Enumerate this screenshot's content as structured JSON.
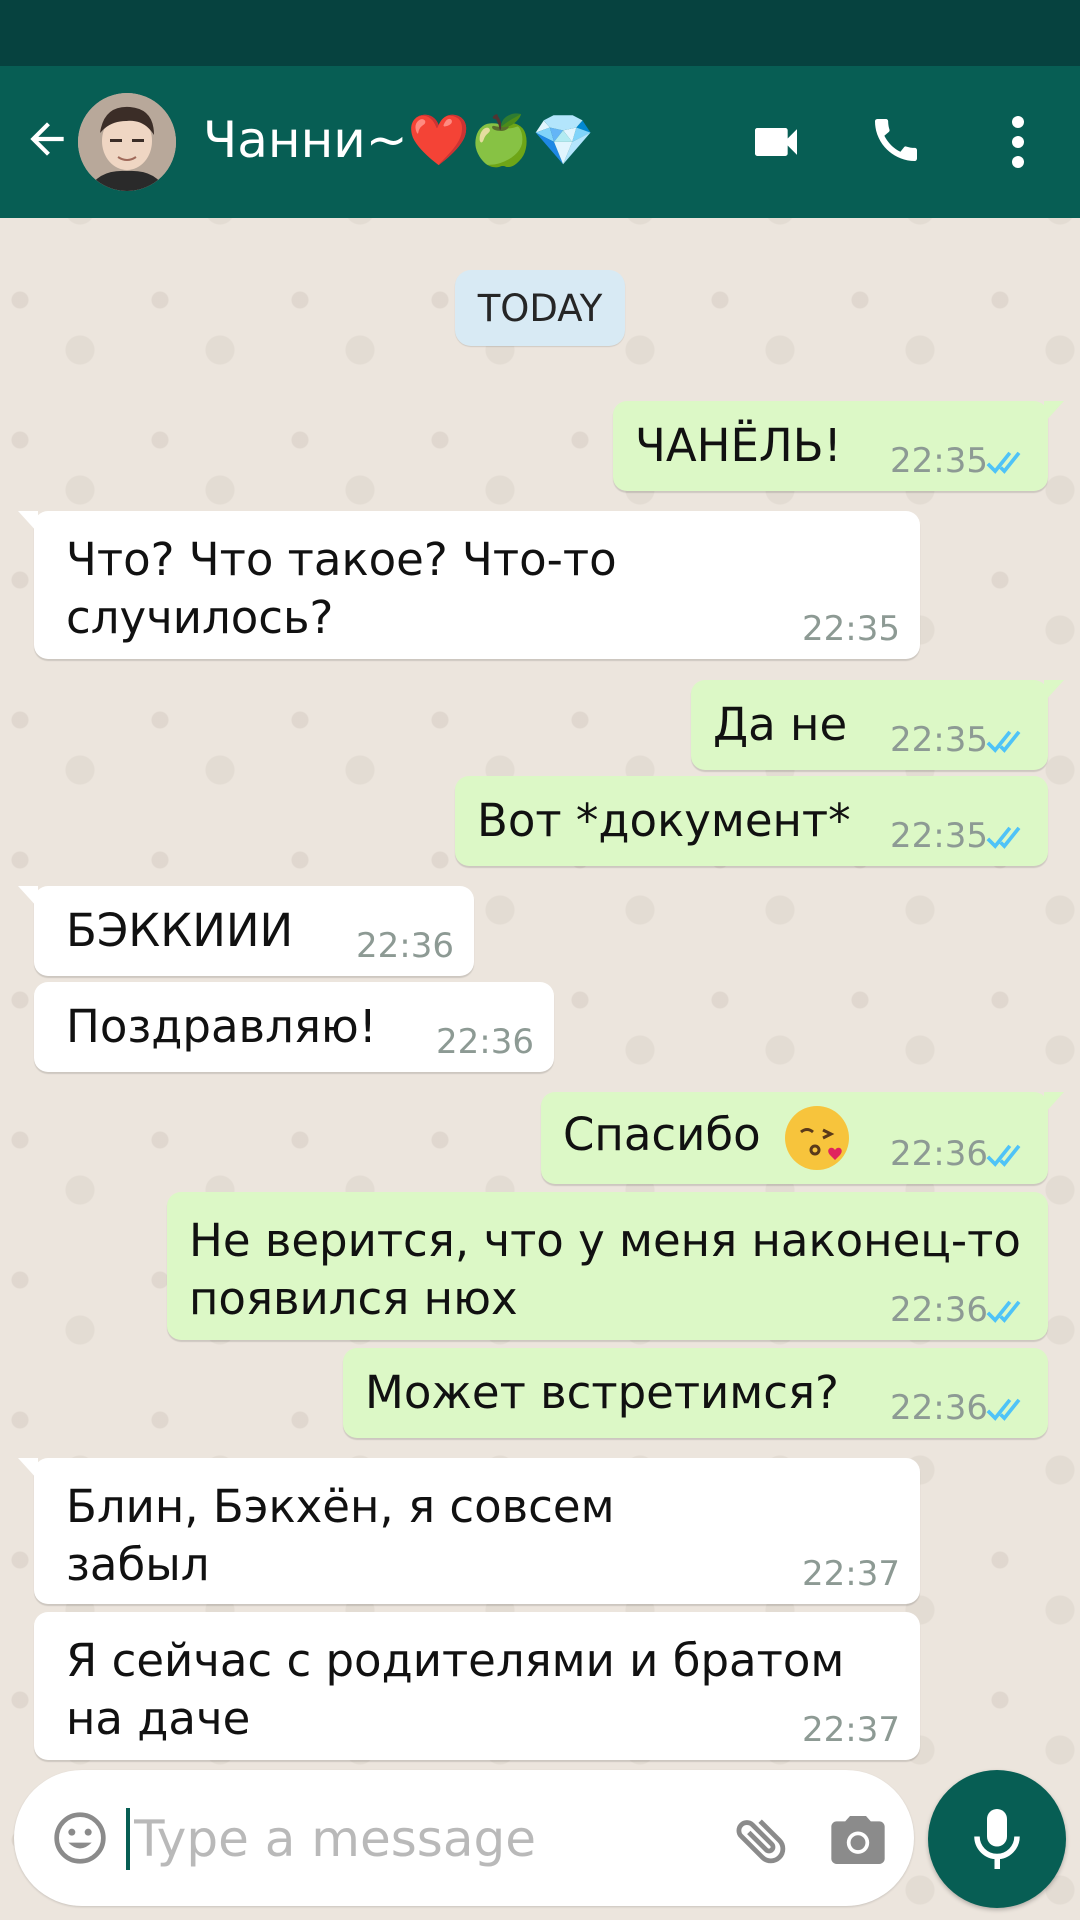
{
  "header": {
    "contact_name": "Чанни~❤️🍏💎"
  },
  "chat": {
    "date_label": "TODAY",
    "messages": [
      {
        "direction": "out",
        "text": "ЧАНЁЛЬ!",
        "time": "22:35",
        "status": "read"
      },
      {
        "direction": "in",
        "lines": [
          "Что? Что такое? Что-то",
          "случилось?"
        ],
        "time": "22:35"
      },
      {
        "direction": "out",
        "text": "Да не",
        "time": "22:35",
        "status": "read"
      },
      {
        "direction": "out",
        "text": "Вот *документ*",
        "time": "22:35",
        "status": "read"
      },
      {
        "direction": "in",
        "text": "БЭККИИИ",
        "time": "22:36"
      },
      {
        "direction": "in",
        "text": "Поздравляю!",
        "time": "22:36"
      },
      {
        "direction": "out",
        "text": "Спасибо",
        "emoji": "kissing-face-with-heart",
        "time": "22:36",
        "status": "read"
      },
      {
        "direction": "out",
        "lines": [
          "Не верится, что у меня наконец-то",
          "появился нюх"
        ],
        "time": "22:36",
        "status": "read"
      },
      {
        "direction": "out",
        "text": "Может встретимся?",
        "time": "22:36",
        "status": "read"
      },
      {
        "direction": "in",
        "lines": [
          "Блин, Бэкхён, я совсем",
          "забыл"
        ],
        "time": "22:37"
      },
      {
        "direction": "in",
        "lines": [
          "Я сейчас с родителями и братом",
          "на даче"
        ],
        "time": "22:37"
      }
    ]
  },
  "composer": {
    "placeholder": "Type a message"
  },
  "colors": {
    "header": "#075e54",
    "status_bar": "#06423f",
    "outgoing_bubble": "#dcf8c6",
    "incoming_bubble": "#ffffff",
    "read_ticks": "#4fc3f7"
  }
}
